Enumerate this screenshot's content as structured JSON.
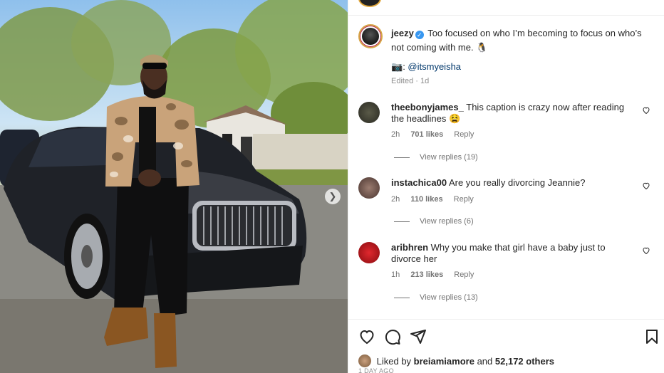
{
  "post": {
    "username": "jeezy",
    "caption": "Too focused on who I’m becoming to focus on who’s not coming with me. 🐧",
    "credit_emoji": "📷",
    "credit_mention": "@itsmyeisha",
    "edited": "Edited · 1d"
  },
  "comments": [
    {
      "username": "theebonyjames_",
      "text": "This caption is crazy now after reading the headlines 😫",
      "age": "2h",
      "likes": "701 likes",
      "reply": "Reply",
      "view_replies": "View replies (19)",
      "avatar_color": "#3a3a30"
    },
    {
      "username": "instachica00",
      "text": "Are you really divorcing Jeannie?",
      "age": "2h",
      "likes": "110 likes",
      "reply": "Reply",
      "view_replies": "View replies (6)",
      "avatar_color": "#6b5248"
    },
    {
      "username": "aribhren",
      "text": "Why you make that girl have a baby just to divorce her",
      "age": "1h",
      "likes": "213 likes",
      "reply": "Reply",
      "view_replies": "View replies (13)",
      "avatar_color": "#c4161c"
    }
  ],
  "likes_summary": {
    "prefix": "Liked by",
    "user": "breiamiamore",
    "and": "and",
    "count": "52,172 others"
  },
  "time_ago": "1 DAY AGO",
  "icons": [
    "heart-icon",
    "comment-icon",
    "share-icon",
    "bookmark-icon",
    "verified-badge-icon",
    "next-arrow-icon"
  ],
  "colors": {
    "accent_link": "#00376b",
    "verified": "#3897f0",
    "story_ring": "#d6a545"
  }
}
